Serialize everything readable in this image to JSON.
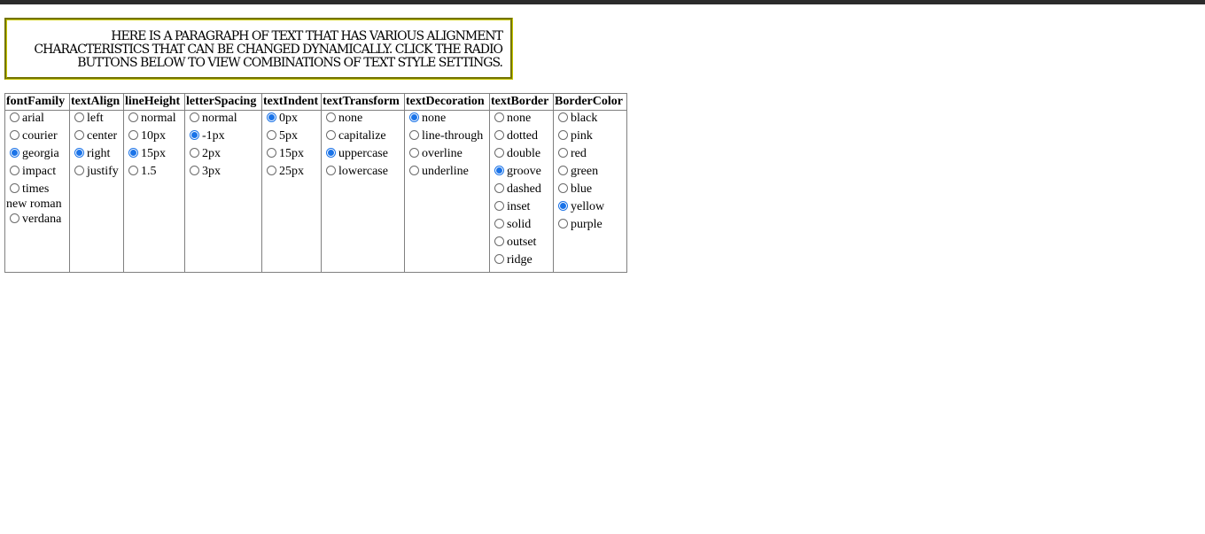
{
  "paragraph": {
    "text": "Here is a paragraph of text that has various alignment characteristics that can be changed dynamically. Click the radio buttons below to view combinations of text style settings.",
    "border_color": "#c8c800"
  },
  "groups": [
    {
      "header": "fontFamily",
      "options": [
        {
          "label": "arial",
          "checked": false
        },
        {
          "label": "courier",
          "checked": false
        },
        {
          "label": "georgia",
          "checked": true
        },
        {
          "label": "impact",
          "checked": false
        },
        {
          "label": "times new roman",
          "checked": false
        },
        {
          "label": "verdana",
          "checked": false
        }
      ]
    },
    {
      "header": "textAlign",
      "options": [
        {
          "label": "left",
          "checked": false
        },
        {
          "label": "center",
          "checked": false
        },
        {
          "label": "right",
          "checked": true
        },
        {
          "label": "justify",
          "checked": false
        }
      ]
    },
    {
      "header": "lineHeight",
      "options": [
        {
          "label": "normal",
          "checked": false
        },
        {
          "label": "10px",
          "checked": false
        },
        {
          "label": "15px",
          "checked": true
        },
        {
          "label": "1.5",
          "checked": false
        }
      ]
    },
    {
      "header": "letterSpacing",
      "options": [
        {
          "label": "normal",
          "checked": false
        },
        {
          "label": "-1px",
          "checked": true
        },
        {
          "label": "2px",
          "checked": false
        },
        {
          "label": "3px",
          "checked": false
        }
      ]
    },
    {
      "header": "textIndent",
      "options": [
        {
          "label": "0px",
          "checked": true
        },
        {
          "label": "5px",
          "checked": false
        },
        {
          "label": "15px",
          "checked": false
        },
        {
          "label": "25px",
          "checked": false
        }
      ]
    },
    {
      "header": "textTransform",
      "options": [
        {
          "label": "none",
          "checked": false
        },
        {
          "label": "capitalize",
          "checked": false
        },
        {
          "label": "uppercase",
          "checked": true
        },
        {
          "label": "lowercase",
          "checked": false
        }
      ]
    },
    {
      "header": "textDecoration",
      "options": [
        {
          "label": "none",
          "checked": true
        },
        {
          "label": "line-through",
          "checked": false
        },
        {
          "label": "overline",
          "checked": false
        },
        {
          "label": "underline",
          "checked": false
        }
      ]
    },
    {
      "header": "textBorder",
      "options": [
        {
          "label": "none",
          "checked": false
        },
        {
          "label": "dotted",
          "checked": false
        },
        {
          "label": "double",
          "checked": false
        },
        {
          "label": "groove",
          "checked": true
        },
        {
          "label": "dashed",
          "checked": false
        },
        {
          "label": "inset",
          "checked": false
        },
        {
          "label": "solid",
          "checked": false
        },
        {
          "label": "outset",
          "checked": false
        },
        {
          "label": "ridge",
          "checked": false
        }
      ]
    },
    {
      "header": "BorderColor",
      "options": [
        {
          "label": "black",
          "checked": false
        },
        {
          "label": "pink",
          "checked": false
        },
        {
          "label": "red",
          "checked": false
        },
        {
          "label": "green",
          "checked": false
        },
        {
          "label": "blue",
          "checked": false
        },
        {
          "label": "yellow",
          "checked": true
        },
        {
          "label": "purple",
          "checked": false
        }
      ]
    }
  ]
}
